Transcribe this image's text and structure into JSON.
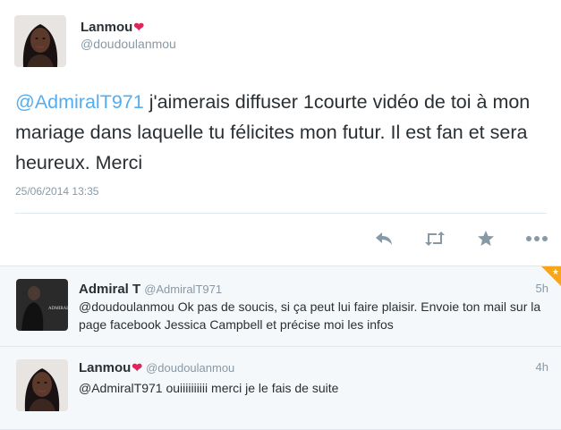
{
  "main_tweet": {
    "name": "Lanmou",
    "heart": "❤",
    "handle": "@doudoulanmou",
    "mention": "@AdmiralT971",
    "text": " j'aimerais diffuser 1courte vidéo de toi à mon mariage dans laquelle tu félicites mon futur. Il est fan et sera heureux. Merci",
    "date": "25/06/2014 13:35",
    "actions": [
      "reply-icon",
      "retweet-icon",
      "favorite-icon",
      "more-icon"
    ]
  },
  "replies": [
    {
      "name": "Admiral T",
      "handle": "@AdmiralT971",
      "time": "5h",
      "text": "@doudoulanmou Ok pas de soucis, si ça peut lui faire plaisir. Envoie ton mail sur la page facebook Jessica Campbell et précise moi les infos",
      "avatar_text": "ADMIRAL T"
    },
    {
      "name": "Lanmou",
      "heart": "❤",
      "handle": "@doudoulanmou",
      "time": "4h",
      "text": "@AdmiralT971 ouiiiiiiiiii merci je le fais de suite"
    }
  ],
  "colors": {
    "link": "#55acee",
    "muted": "#8899a6",
    "text": "#292f33",
    "heart": "#e0245e",
    "reply_bg": "#f5f8fa",
    "corner": "#f7a61b"
  }
}
